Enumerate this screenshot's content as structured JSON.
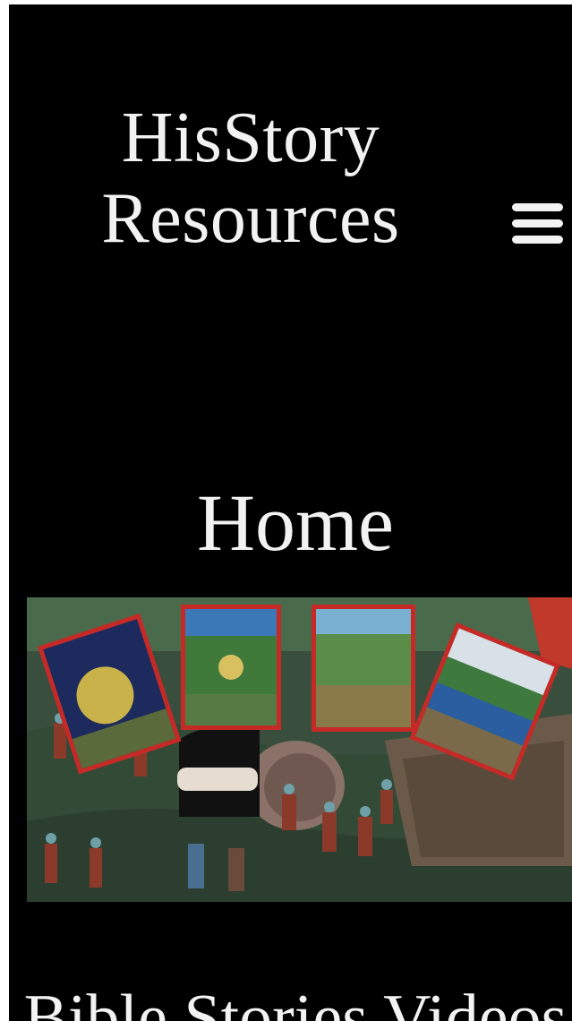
{
  "header": {
    "site_title": "HisStory Resources",
    "menu_icon": "hamburger-menu-icon"
  },
  "main": {
    "page_heading": "Home",
    "hero_image": "collage of illustrated Bible story paintings",
    "section_heading": "Bible Stories Videos"
  },
  "colors": {
    "background": "#000000",
    "text": "#f2f2f2",
    "frame_red": "#c62a27",
    "grass_green": "#3d5a3c"
  }
}
